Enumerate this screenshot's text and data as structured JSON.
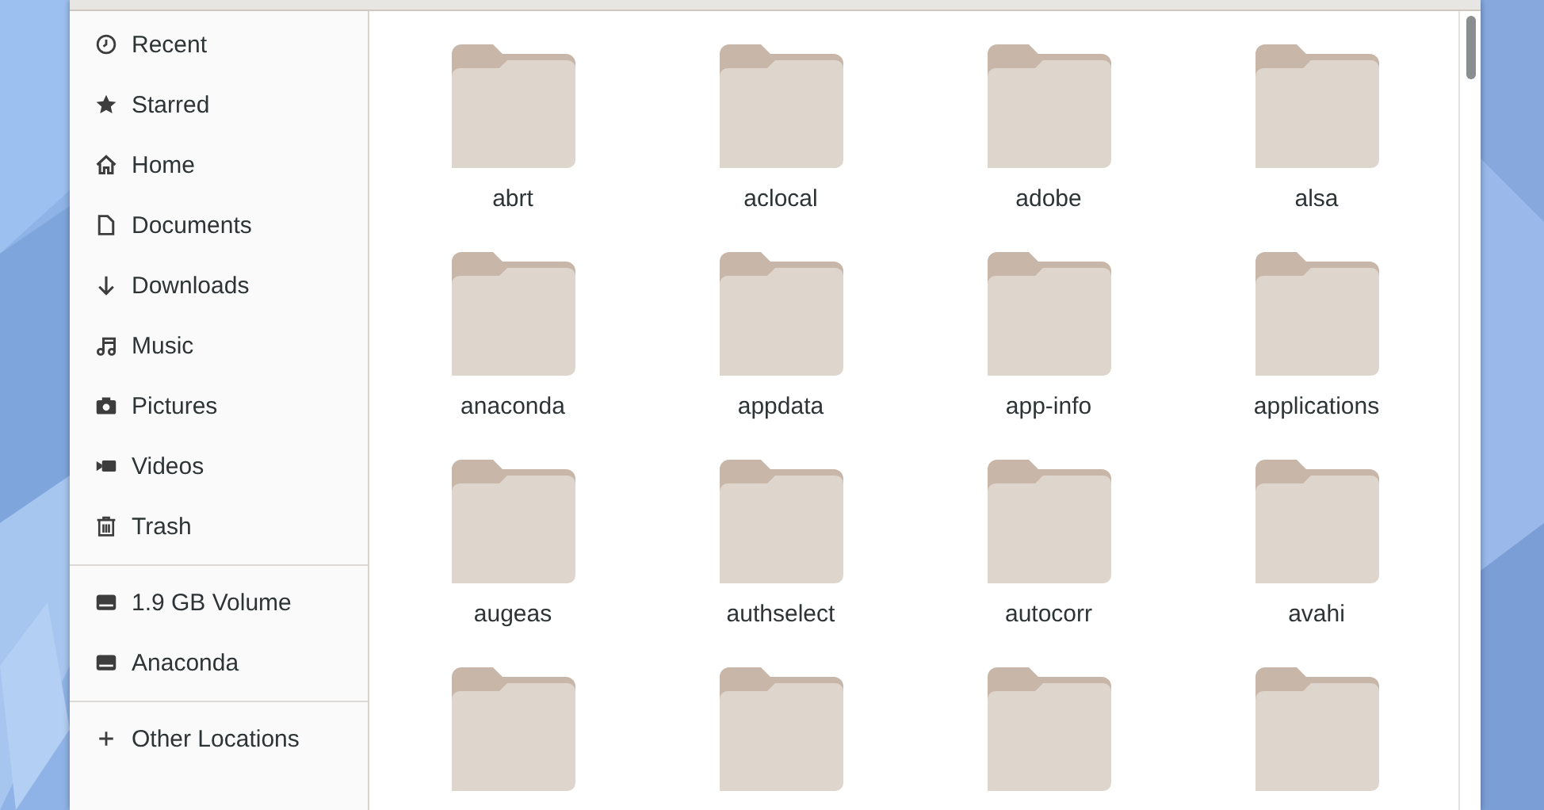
{
  "sidebar": {
    "sections": [
      {
        "items": [
          {
            "label": "Recent",
            "kind": "recent"
          },
          {
            "label": "Starred",
            "kind": "starred"
          },
          {
            "label": "Home",
            "kind": "home"
          },
          {
            "label": "Documents",
            "kind": "documents"
          },
          {
            "label": "Downloads",
            "kind": "downloads"
          },
          {
            "label": "Music",
            "kind": "music"
          },
          {
            "label": "Pictures",
            "kind": "pictures"
          },
          {
            "label": "Videos",
            "kind": "videos"
          },
          {
            "label": "Trash",
            "kind": "trash"
          }
        ]
      },
      {
        "items": [
          {
            "label": "1.9 GB Volume",
            "kind": "drive"
          },
          {
            "label": "Anaconda",
            "kind": "drive"
          }
        ]
      },
      {
        "items": [
          {
            "label": "Other Locations",
            "kind": "other"
          }
        ]
      }
    ]
  },
  "files": [
    {
      "name": "abrt",
      "kind": "folder"
    },
    {
      "name": "aclocal",
      "kind": "folder"
    },
    {
      "name": "adobe",
      "kind": "folder"
    },
    {
      "name": "alsa",
      "kind": "folder"
    },
    {
      "name": "anaconda",
      "kind": "folder"
    },
    {
      "name": "appdata",
      "kind": "folder"
    },
    {
      "name": "app-info",
      "kind": "folder"
    },
    {
      "name": "applications",
      "kind": "folder"
    },
    {
      "name": "augeas",
      "kind": "folder"
    },
    {
      "name": "authselect",
      "kind": "folder"
    },
    {
      "name": "autocorr",
      "kind": "folder"
    },
    {
      "name": "avahi",
      "kind": "folder"
    },
    {
      "kind": "folder"
    },
    {
      "kind": "folder"
    },
    {
      "kind": "folder"
    },
    {
      "kind": "folder"
    }
  ]
}
